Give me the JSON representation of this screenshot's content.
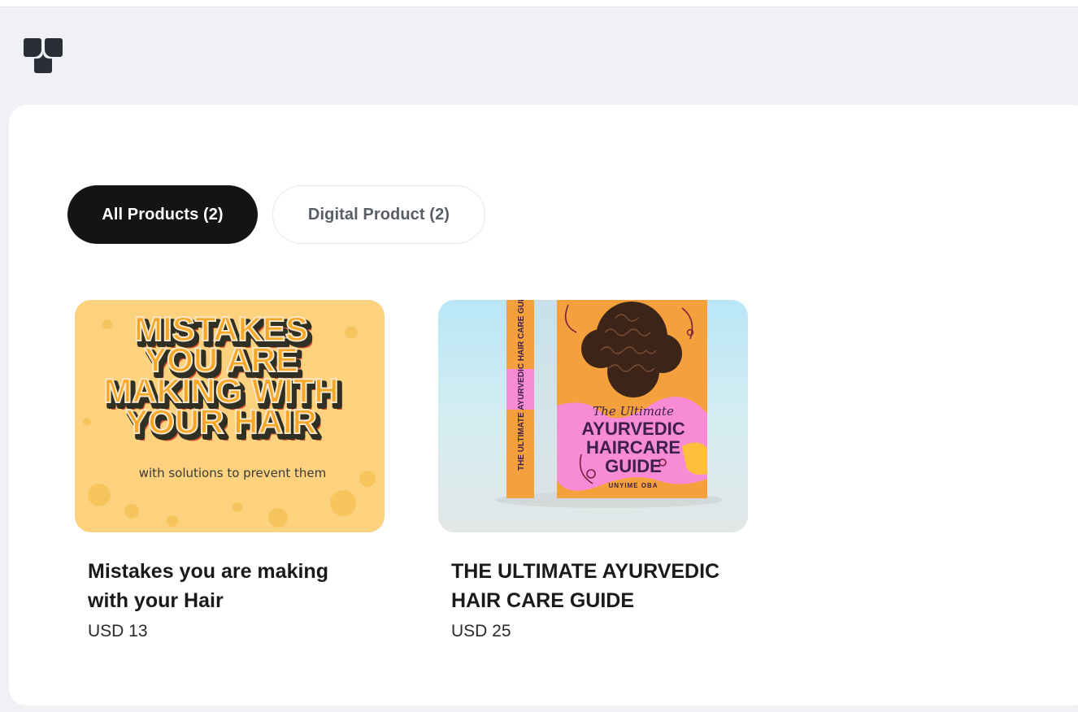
{
  "brand": {
    "logo_icon": "store-logo-icon"
  },
  "tabs": [
    {
      "label": "All Products (2)",
      "active": true
    },
    {
      "label": "Digital Product (2)",
      "active": false
    }
  ],
  "products": [
    {
      "title": "Mistakes you are making with your Hair",
      "price": "USD 13",
      "cover": {
        "headline_lines": [
          "MISTAKES",
          "YOU ARE",
          "MAKING WITH",
          "YOUR HAIR"
        ],
        "subtitle": "with solutions to prevent them"
      }
    },
    {
      "title": "THE ULTIMATE AYURVEDIC HAIR CARE GUIDE",
      "price": "USD 25",
      "cover": {
        "script_text": "The Ultimate",
        "title_lines": [
          "AYURVEDIC",
          "HAIRCARE",
          "GUIDE"
        ],
        "author": "UNYIME OBA",
        "spine_text": "THE ULTIMATE AYURVEDIC HAIR CARE GUIDE"
      }
    }
  ],
  "colors": {
    "page_bg": "#f0f1f5",
    "active_tab_bg": "#141414",
    "cover1_bg": "#fdd27f",
    "cover1_text": "#f6a623",
    "cover2_book": "#f4a03c",
    "cover2_pink": "#f78bd6"
  }
}
